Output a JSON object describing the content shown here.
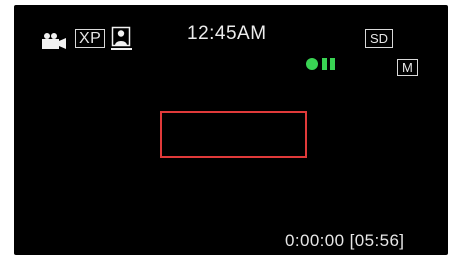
{
  "status_bar": {
    "mode_icon": "video-camera-icon",
    "quality": "XP",
    "face_icon": "face-detection-icon",
    "clock": "12:45AM",
    "media": "SD",
    "recording_icon": "record-status-icon",
    "recording_color": "#39d353",
    "manual_mode": "M"
  },
  "focus_frame": {
    "color": "#e03a3a"
  },
  "time_readout": {
    "text": "0:00:00 [05:56]"
  }
}
